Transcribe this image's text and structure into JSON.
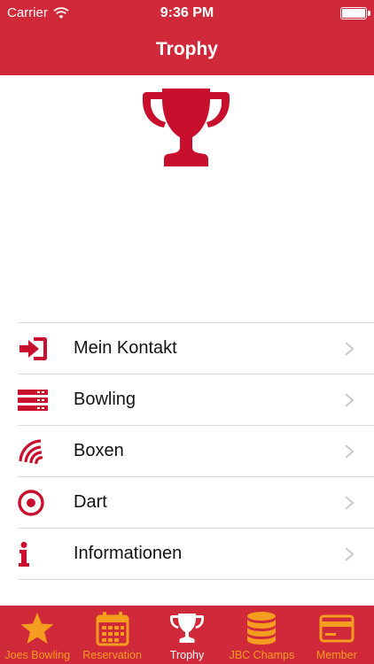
{
  "status_bar": {
    "carrier": "Carrier",
    "time": "9:36 PM"
  },
  "nav": {
    "title": "Trophy"
  },
  "hero": {
    "icon": "trophy-icon"
  },
  "menu": {
    "items": [
      {
        "label": "Mein Kontakt",
        "icon": "login-icon"
      },
      {
        "label": "Bowling",
        "icon": "lanes-icon"
      },
      {
        "label": "Boxen",
        "icon": "boxing-icon"
      },
      {
        "label": "Dart",
        "icon": "target-icon"
      },
      {
        "label": "Informationen",
        "icon": "info-icon"
      }
    ]
  },
  "tabbar": {
    "tabs": [
      {
        "label": "Joes Bowling",
        "icon": "star-icon",
        "active": false
      },
      {
        "label": "Reservation",
        "icon": "calendar-icon",
        "active": false
      },
      {
        "label": "Trophy",
        "icon": "trophy-icon",
        "active": true
      },
      {
        "label": "JBC Champs",
        "icon": "coins-stack-icon",
        "active": false
      },
      {
        "label": "Member",
        "icon": "card-icon",
        "active": false
      }
    ]
  },
  "colors": {
    "brand_red": "#d02a3a",
    "icon_red": "#c8102e",
    "tab_inactive": "#f49d1f",
    "tab_active": "#ffffff"
  }
}
